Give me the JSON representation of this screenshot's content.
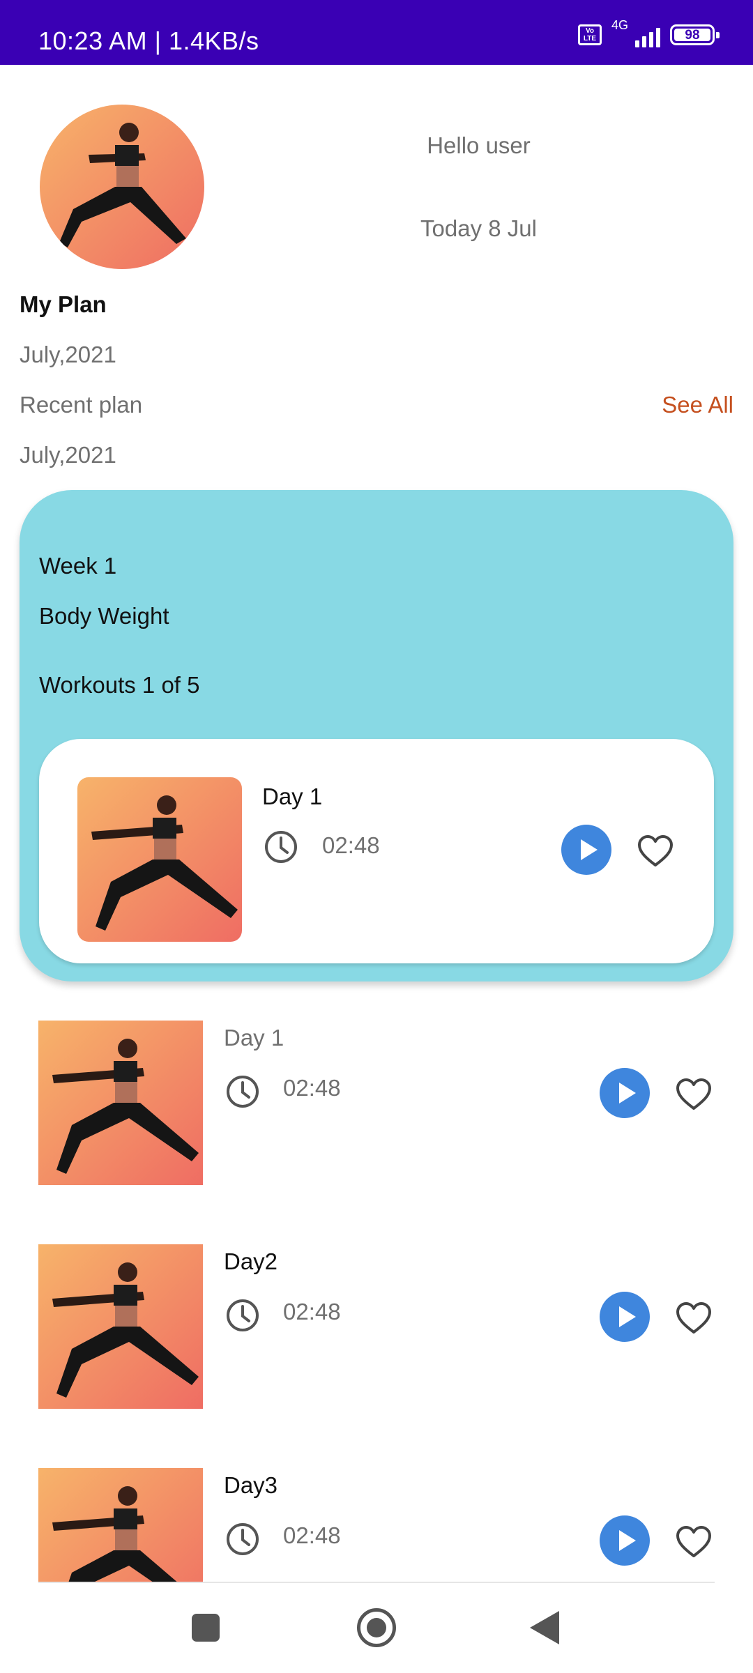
{
  "status_bar": {
    "time_speed": "10:23 AM | 1.4KB/s",
    "volte_label": "Vo LTE",
    "network": "4G",
    "battery": "98"
  },
  "header": {
    "greeting": "Hello user",
    "date": "Today 8 Jul"
  },
  "plan": {
    "title": "My Plan",
    "month": "July,2021",
    "recent_label": "Recent plan",
    "see_all": "See All",
    "recent_month": "July,2021"
  },
  "plan_card": {
    "week": "Week 1",
    "type": "Body Weight",
    "workouts": "Workouts 1 of 5",
    "featured": {
      "day": "Day 1",
      "time": "02:48"
    }
  },
  "list": [
    {
      "day": "Day 1",
      "time": "02:48"
    },
    {
      "day": "Day2",
      "time": "02:48"
    },
    {
      "day": "Day3",
      "time": "02:48"
    }
  ],
  "icons": {
    "clock": "clock-icon",
    "play": "play-icon",
    "heart": "heart-outline-icon",
    "nav_recents": "square-icon",
    "nav_home": "circle-icon",
    "nav_back": "triangle-back-icon"
  },
  "colors": {
    "status_bar": "#3a00b4",
    "card": "#88d9e4",
    "accent": "#c5501f",
    "play": "#3f86dd"
  }
}
